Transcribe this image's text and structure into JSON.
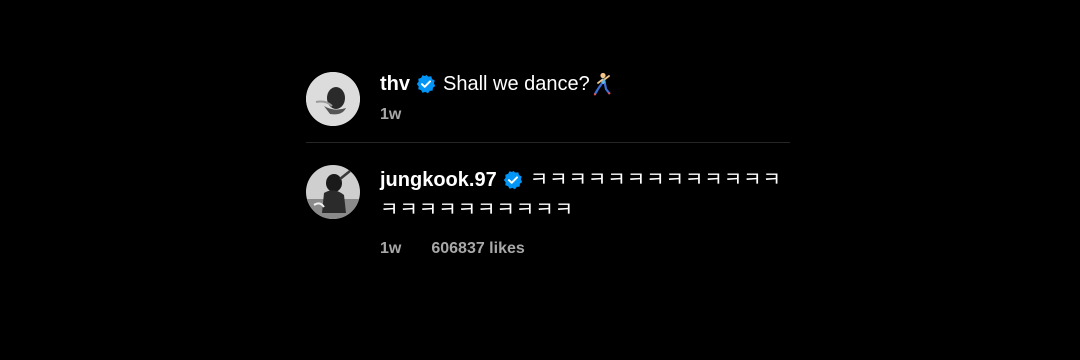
{
  "caption": {
    "username": "thv",
    "text": "Shall we dance?",
    "emoji": "dancer-emoji",
    "time": "1w"
  },
  "comment": {
    "username": "jungkook.97",
    "text_line1": "ㅋㅋㅋㅋㅋㅋㅋㅋㅋㅋㅋㅋㅋ",
    "text_line2": "ㅋㅋㅋㅋㅋㅋㅋㅋㅋㅋ",
    "time": "1w",
    "likes": "606837 likes"
  },
  "colors": {
    "background": "#000000",
    "verified_badge": "#0095f6",
    "meta_text": "#a8a8a8",
    "divider": "#262626"
  }
}
